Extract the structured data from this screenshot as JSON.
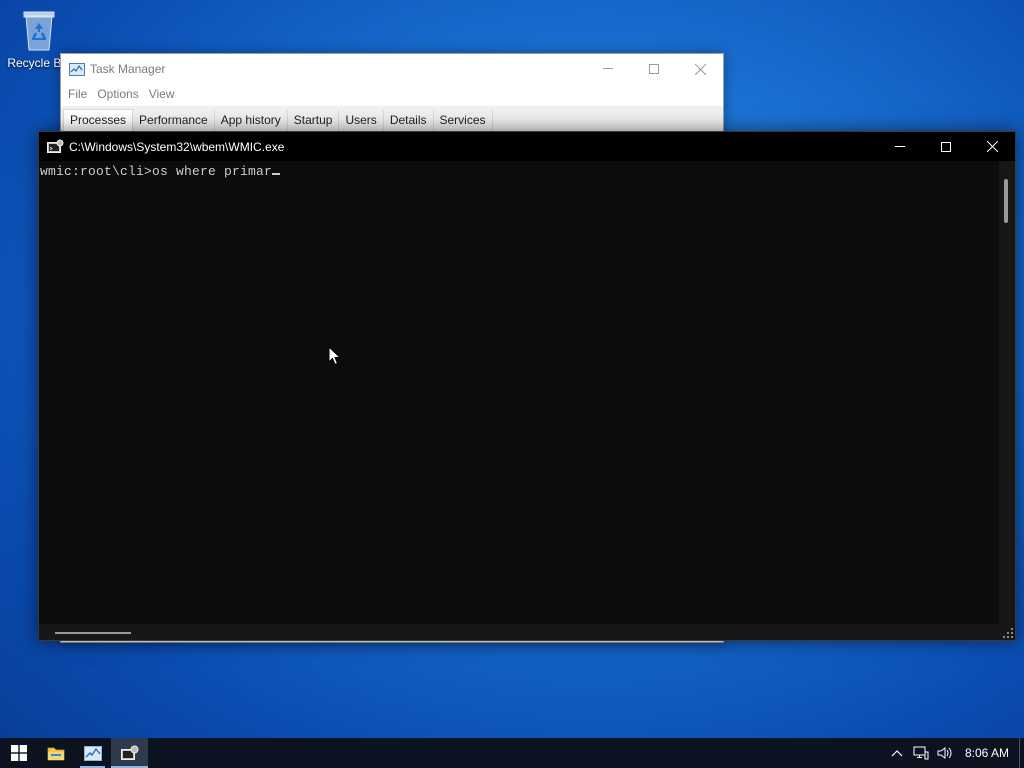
{
  "desktop": {
    "icons": [
      {
        "label": "Recycle Bin",
        "icon": "recycle-bin-icon"
      }
    ]
  },
  "task_manager": {
    "title": "Task Manager",
    "menu": [
      "File",
      "Options",
      "View"
    ],
    "tabs": [
      "Processes",
      "Performance",
      "App history",
      "Startup",
      "Users",
      "Details",
      "Services"
    ],
    "active_tab": "Processes",
    "controls": {
      "minimize": "—",
      "maximize": "☐",
      "close": "✕"
    }
  },
  "console": {
    "title": "C:\\Windows\\System32\\wbem\\WMIC.exe",
    "prompt": "wmic:root\\cli>",
    "input": "os where primar",
    "background": "#0c0c0c",
    "foreground": "#cccccc"
  },
  "taskbar": {
    "items": [
      {
        "icon": "windows-start-icon",
        "state": "normal"
      },
      {
        "icon": "file-explorer-icon",
        "state": "normal"
      },
      {
        "icon": "task-manager-icon",
        "state": "running"
      },
      {
        "icon": "console-icon",
        "state": "active"
      }
    ],
    "tray": {
      "icons": [
        "chevron-up-icon",
        "network-icon",
        "volume-icon"
      ],
      "time": "8:06 AM"
    }
  }
}
